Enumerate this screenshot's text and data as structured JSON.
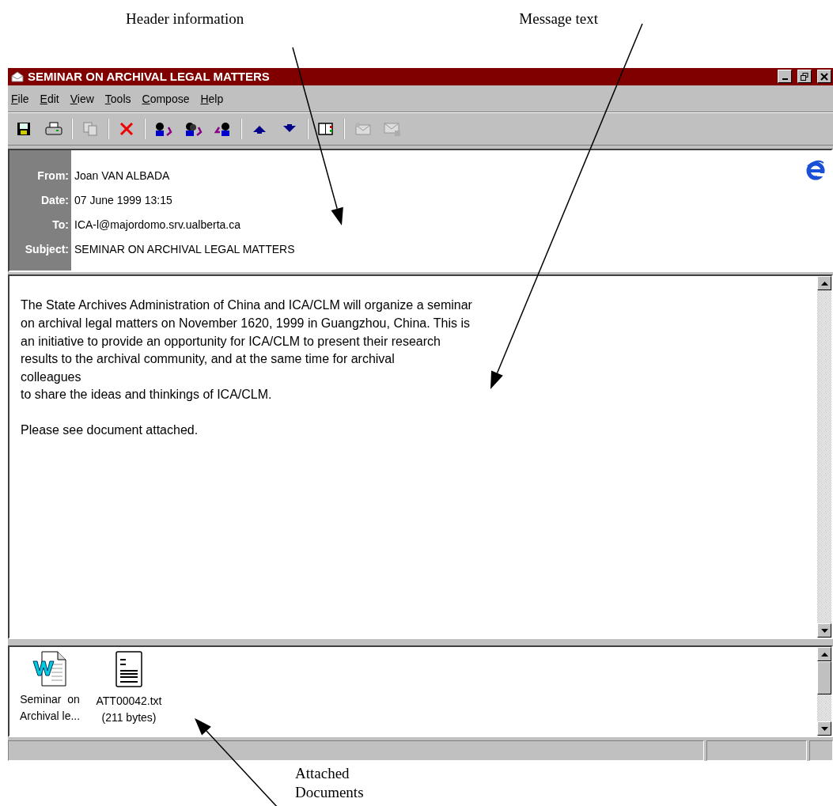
{
  "annotations": {
    "header": "Header information",
    "message": "Message text",
    "attachments": "Attached\nDocuments"
  },
  "window": {
    "title": "SEMINAR ON ARCHIVAL LEGAL MATTERS"
  },
  "menu": [
    "File",
    "Edit",
    "View",
    "Tools",
    "Compose",
    "Help"
  ],
  "toolbar": [
    [
      {
        "kind": "save",
        "disabled": false
      },
      {
        "kind": "print",
        "disabled": false
      }
    ],
    [
      {
        "kind": "copy",
        "disabled": true
      }
    ],
    [
      {
        "kind": "delete",
        "disabled": false
      }
    ],
    [
      {
        "kind": "reply",
        "disabled": false
      },
      {
        "kind": "reply-all",
        "disabled": false
      },
      {
        "kind": "forward",
        "disabled": false
      }
    ],
    [
      {
        "kind": "previous",
        "disabled": false
      },
      {
        "kind": "next",
        "disabled": false
      }
    ],
    [
      {
        "kind": "address-book",
        "disabled": false
      }
    ],
    [
      {
        "kind": "sign",
        "disabled": true
      },
      {
        "kind": "encrypt",
        "disabled": true
      }
    ]
  ],
  "header": [
    {
      "label": "From:",
      "value": "Joan VAN ALBADA"
    },
    {
      "label": "Date:",
      "value": "07 June 1999 13:15"
    },
    {
      "label": "To:",
      "value": "ICA-l@majordomo.srv.ualberta.ca"
    },
    {
      "label": "Subject:",
      "value": "SEMINAR ON ARCHIVAL LEGAL MATTERS"
    }
  ],
  "message": [
    "The State Archives Administration of China and ICA/CLM will organize a seminar\non archival legal matters on November 1620, 1999 in Guangzhou, China. This is\nan initiative to provide an opportunity for ICA/CLM to present their research\nresults to the archival community, and at the same time for archival\ncolleagues\nto share the ideas and thinkings of ICA/CLM.",
    "Please see document attached."
  ],
  "attachments": [
    {
      "kind": "word",
      "label": "Seminar  on\nArchival le..."
    },
    {
      "kind": "text",
      "label": "ATT00042.txt\n(211 bytes)"
    }
  ]
}
